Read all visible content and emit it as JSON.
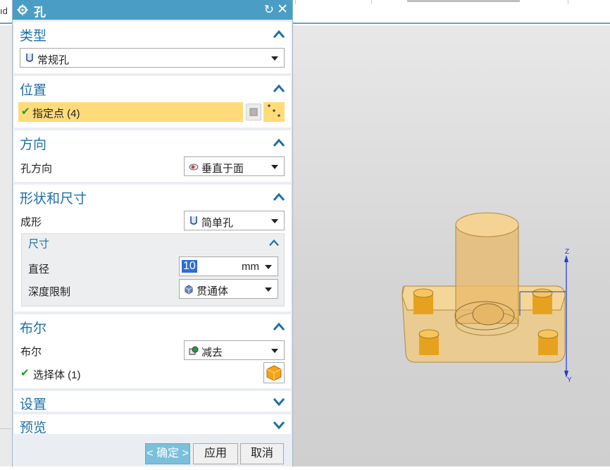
{
  "app_strip": {
    "fragment": "ıd"
  },
  "dialog": {
    "title": "孔",
    "reset_label": "↻",
    "close_label": "✕"
  },
  "type_group": {
    "title": "类型",
    "value": "常规孔"
  },
  "position_group": {
    "title": "位置",
    "point_label": "指定点 (4)"
  },
  "direction_group": {
    "title": "方向",
    "label": "孔方向",
    "value": "垂直于面"
  },
  "shape_group": {
    "title": "形状和尺寸",
    "form_label": "成形",
    "form_value": "简单孔",
    "dimension": {
      "title": "尺寸",
      "diameter_label": "直径",
      "diameter_value": "10",
      "diameter_unit": "mm",
      "depth_limit_label": "深度限制",
      "depth_limit_value": "贯通体"
    }
  },
  "boolean_group": {
    "title": "布尔",
    "label": "布尔",
    "value": "减去",
    "select_body_label": "选择体 (1)"
  },
  "settings_group": {
    "title": "设置"
  },
  "preview_group": {
    "title": "预览"
  },
  "footer": {
    "ok": "< 确定 >",
    "apply": "应用",
    "cancel": "取消"
  },
  "viewport": {
    "z_label": "Z",
    "y_label": "Y"
  },
  "colors": {
    "title_bar": "#4a9ec6",
    "group_title": "#1e6fa8",
    "highlight": "#ffdb7a",
    "ok_button": "#7ac0dc",
    "axis": "#1e3bd6"
  }
}
